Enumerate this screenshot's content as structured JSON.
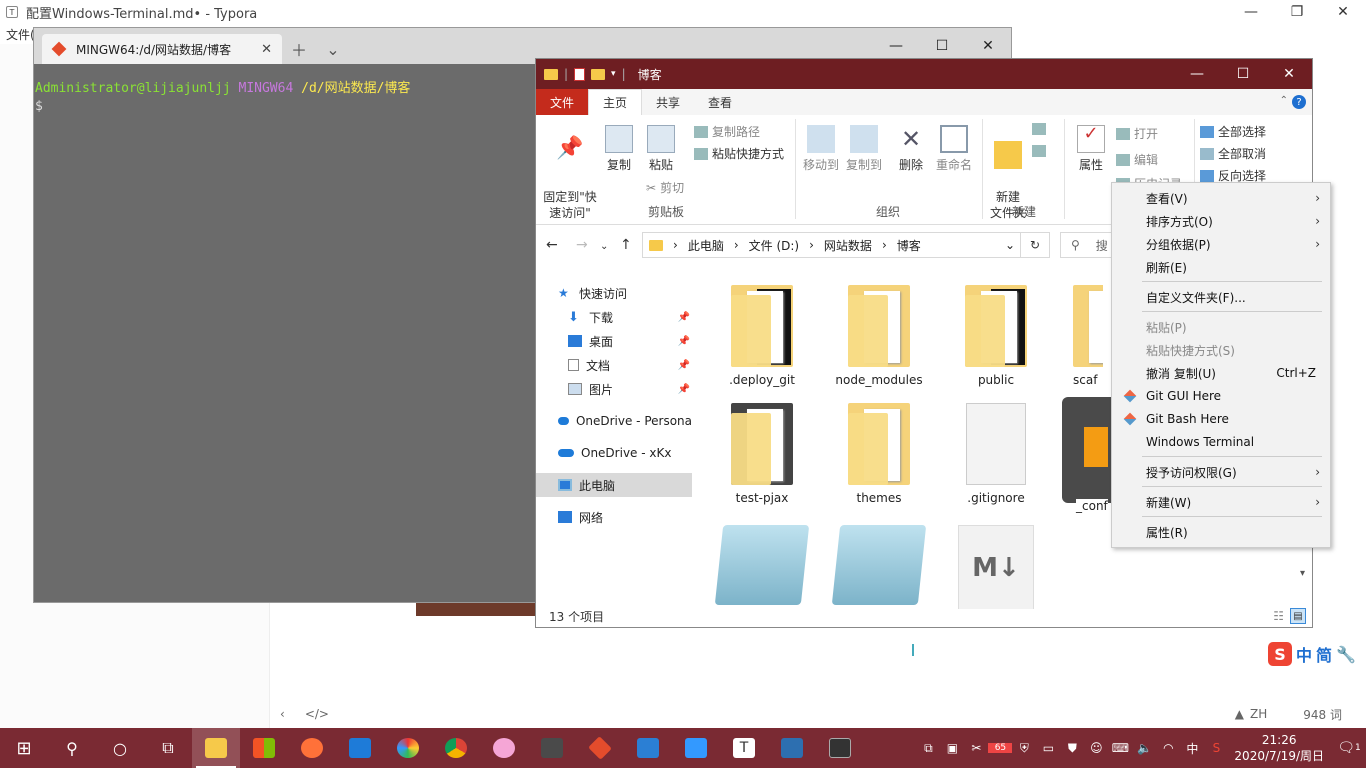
{
  "typora": {
    "title": "配置Windows-Terminal.md• - Typora",
    "menu_label": "文件(",
    "footer_lang": "ZH",
    "footer_words": "948 词"
  },
  "terminal": {
    "tab_title": "MINGW64:/d/网站数据/博客",
    "prompt_user": "Administrator@lijiajunljj",
    "prompt_env": "MINGW64",
    "prompt_path": "/d/网站数据/博客",
    "prompt_symbol": "$"
  },
  "explorer": {
    "title": "博客",
    "tabs": [
      "文件",
      "主页",
      "共享",
      "查看"
    ],
    "ribbon": {
      "pin": "固定到\"快\n速访问\"",
      "copy": "复制",
      "paste": "粘贴",
      "copy_path": "复制路径",
      "paste_shortcut": "粘贴快捷方式",
      "cut": "剪切",
      "group_clipboard": "剪贴板",
      "move_to": "移动到",
      "copy_to": "复制到",
      "delete": "删除",
      "rename": "重命名",
      "group_organize": "组织",
      "new_folder": "新建\n文件夹",
      "group_new": "新建",
      "properties": "属性",
      "open": "打开",
      "edit": "编辑",
      "history": "历史记录",
      "select_all": "全部选择",
      "select_none": "全部取消",
      "invert_select": "反向选择"
    },
    "breadcrumb": [
      "此电脑",
      "文件 (D:)",
      "网站数据",
      "博客"
    ],
    "search_placeholder": "搜",
    "nav": {
      "quick_access": "快速访问",
      "downloads": "下载",
      "desktop": "桌面",
      "documents": "文档",
      "pictures": "图片",
      "onedrive_personal": "OneDrive - Persona",
      "onedrive_xkx": "OneDrive - xKx",
      "this_pc": "此电脑",
      "network": "网络"
    },
    "items": [
      ".deploy_git",
      "node_modules",
      "public",
      "scaf",
      "test-pjax",
      "themes",
      ".gitignore",
      "_conf"
    ],
    "status": "13 个项目"
  },
  "context_menu": {
    "view": "查看(V)",
    "sort": "排序方式(O)",
    "group": "分组依据(P)",
    "refresh": "刷新(E)",
    "customize": "自定义文件夹(F)...",
    "paste": "粘贴(P)",
    "paste_shortcut": "粘贴快捷方式(S)",
    "undo": "撤消 复制(U)",
    "undo_shortcut": "Ctrl+Z",
    "git_gui": "Git GUI Here",
    "git_bash": "Git Bash Here",
    "windows_terminal": "Windows Terminal",
    "grant_access": "授予访问权限(G)",
    "new": "新建(W)",
    "properties": "属性(R)"
  },
  "ime": {
    "lang1": "中",
    "lang2": "简"
  },
  "taskbar": {
    "time": "21:26",
    "date": "2020/7/19/周日",
    "ime_indicator": "中",
    "notification_count": "1",
    "badge": "65"
  },
  "colors": {
    "accent": "#6e1e22",
    "taskbar": "#7a2a33",
    "terminal_bg": "#6b6b6b"
  }
}
